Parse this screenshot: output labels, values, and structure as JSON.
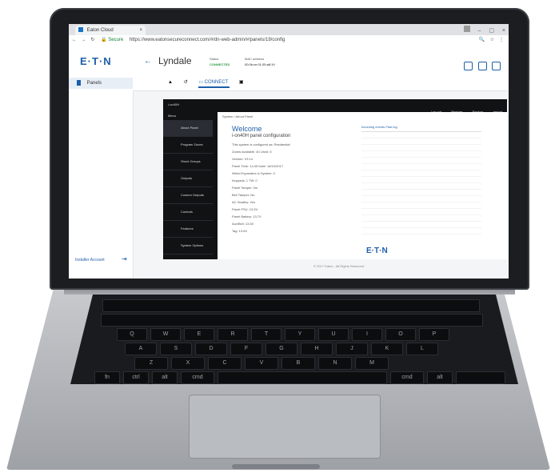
{
  "browser": {
    "tab_title": "Eaton Cloud",
    "secure_label": "Secure",
    "url": "https://www.eatonsecureconnect.com/#/dn-web-admin/#/panels/19/config"
  },
  "app": {
    "logo": "E·T·N",
    "sidebar_item": "Panels",
    "installer_account": "Installer Account",
    "site_name": "Lyndale",
    "status_label": "Status",
    "status_value": "CONNECTED",
    "mac_label": "MAC address",
    "mac_value": "00:0b:ce:01:05:a8:19",
    "tab_connect": "CONNECT"
  },
  "panel": {
    "product": "i-on40H",
    "menu_label": "Menu",
    "menu_items": [
      "About Panel",
      "Program Zones",
      "Shunt Groups",
      "Outputs",
      "Custom Outputs",
      "Controls",
      "Features",
      "System Options"
    ],
    "top_links": [
      "Log out",
      "Restore",
      "Backup",
      "Import"
    ],
    "breadcrumb": "System / About Panel",
    "welcome": "Welcome",
    "subtitle": "i-on40H panel configuration",
    "lines": [
      "This system is configured as: Residential",
      "Zones available: 40   Used: 5",
      "Version: V3.14",
      "Panel Time: 14:45   Date: 16/10/2017",
      "Wired Expanders in System: 0",
      "Keypads: 1   TW: 0",
      "Panel Tamper: No",
      "Bell Tamper: No",
      "AC Healthy: Yes",
      "Panel PSU: 13.5V",
      "Panel Battery: 13.7V",
      "Aux/Bell: 13.6V",
      "Tag: 13.6V"
    ],
    "log_header": "Incoming events  Past log",
    "footer": "© 2017 Eaton - All Rights Reserved",
    "brand": "E·T·N"
  },
  "keyboard": {
    "row_qwerty": [
      "Q",
      "W",
      "E",
      "R",
      "T",
      "Y",
      "U",
      "I",
      "O",
      "P"
    ],
    "row_asdf": [
      "A",
      "S",
      "D",
      "F",
      "G",
      "H",
      "J",
      "K",
      "L"
    ],
    "row_zxcv": [
      "Z",
      "X",
      "C",
      "V",
      "B",
      "N",
      "M"
    ],
    "bottom": [
      "fn",
      "ctrl",
      "alt",
      "cmd",
      "cmd",
      "alt"
    ]
  }
}
